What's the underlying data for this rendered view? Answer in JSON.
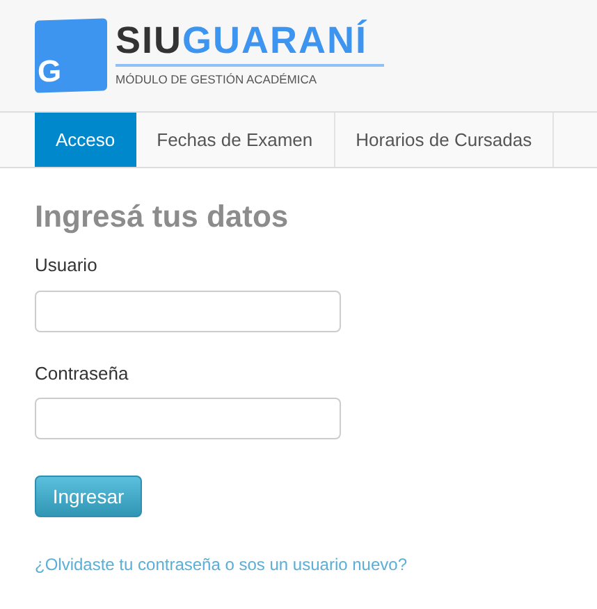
{
  "logo": {
    "mark": "G",
    "prefix": "SIU",
    "name": "GUARANÍ",
    "subtitle": "MÓDULO DE GESTIÓN ACADÉMICA"
  },
  "tabs": [
    {
      "label": "Acceso",
      "selected": true
    },
    {
      "label": "Fechas de Examen",
      "selected": false
    },
    {
      "label": "Horarios de Cursadas",
      "selected": false
    }
  ],
  "heading": "Ingresá tus datos",
  "fields": [
    {
      "label": "Usuario"
    },
    {
      "label": "Contraseña"
    }
  ],
  "submit": "Ingresar",
  "link": "¿Olvidaste tu contraseña o sos un usuario nuevo?"
}
